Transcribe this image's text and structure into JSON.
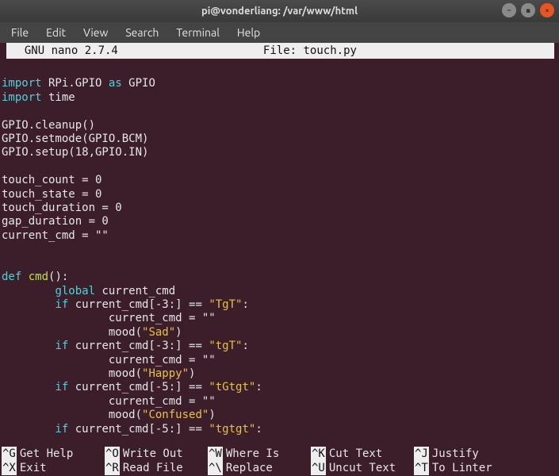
{
  "titlebar": {
    "title": "pi@vonderliang: /var/www/html"
  },
  "menubar": {
    "items": [
      "File",
      "Edit",
      "View",
      "Search",
      "Terminal",
      "Help"
    ]
  },
  "nano": {
    "title": "  GNU nano 2.7.4",
    "file_label": "File: touch.py"
  },
  "code": {
    "lines": [
      {
        "t": "blank"
      },
      {
        "t": "import",
        "module": "RPi.GPIO",
        "as": "GPIO"
      },
      {
        "t": "import",
        "module": "time"
      },
      {
        "t": "blank"
      },
      {
        "t": "plain",
        "text": "GPIO.cleanup()"
      },
      {
        "t": "plain",
        "text": "GPIO.setmode(GPIO.BCM)"
      },
      {
        "t": "plain",
        "text": "GPIO.setup(18,GPIO.IN)"
      },
      {
        "t": "blank"
      },
      {
        "t": "plain",
        "text": "touch_count = 0"
      },
      {
        "t": "plain",
        "text": "touch_state = 0"
      },
      {
        "t": "plain",
        "text": "touch_duration = 0"
      },
      {
        "t": "plain",
        "text": "gap_duration = 0"
      },
      {
        "t": "plain",
        "text": "current_cmd = \"\""
      },
      {
        "t": "blank"
      },
      {
        "t": "blank"
      },
      {
        "t": "def",
        "name": "cmd",
        "sig": "():"
      },
      {
        "t": "global",
        "indent": 8,
        "name": "current_cmd"
      },
      {
        "t": "ifcmp",
        "indent": 8,
        "slice": "[-3:]",
        "val": "TgT"
      },
      {
        "t": "assign_empty",
        "indent": 16,
        "target": "current_cmd"
      },
      {
        "t": "mood",
        "indent": 16,
        "val": "Sad"
      },
      {
        "t": "ifcmp",
        "indent": 8,
        "slice": "[-3:]",
        "val": "tgT"
      },
      {
        "t": "assign_empty",
        "indent": 16,
        "target": "current_cmd"
      },
      {
        "t": "mood",
        "indent": 16,
        "val": "Happy"
      },
      {
        "t": "ifcmp",
        "indent": 8,
        "slice": "[-5:]",
        "val": "tGtgt"
      },
      {
        "t": "assign_empty",
        "indent": 16,
        "target": "current_cmd"
      },
      {
        "t": "mood",
        "indent": 16,
        "val": "Confused"
      },
      {
        "t": "ifcmp",
        "indent": 8,
        "slice": "[-5:]",
        "val": "tgtgt"
      }
    ]
  },
  "shortcuts": {
    "row1": [
      {
        "key": "^G",
        "label": "Get Help"
      },
      {
        "key": "^O",
        "label": "Write Out"
      },
      {
        "key": "^W",
        "label": "Where Is"
      },
      {
        "key": "^K",
        "label": "Cut Text"
      },
      {
        "key": "^J",
        "label": "Justify"
      }
    ],
    "row2": [
      {
        "key": "^X",
        "label": "Exit"
      },
      {
        "key": "^R",
        "label": "Read File"
      },
      {
        "key": "^\\",
        "label": "Replace"
      },
      {
        "key": "^U",
        "label": "Uncut Text"
      },
      {
        "key": "^T",
        "label": "To Linter"
      }
    ]
  }
}
